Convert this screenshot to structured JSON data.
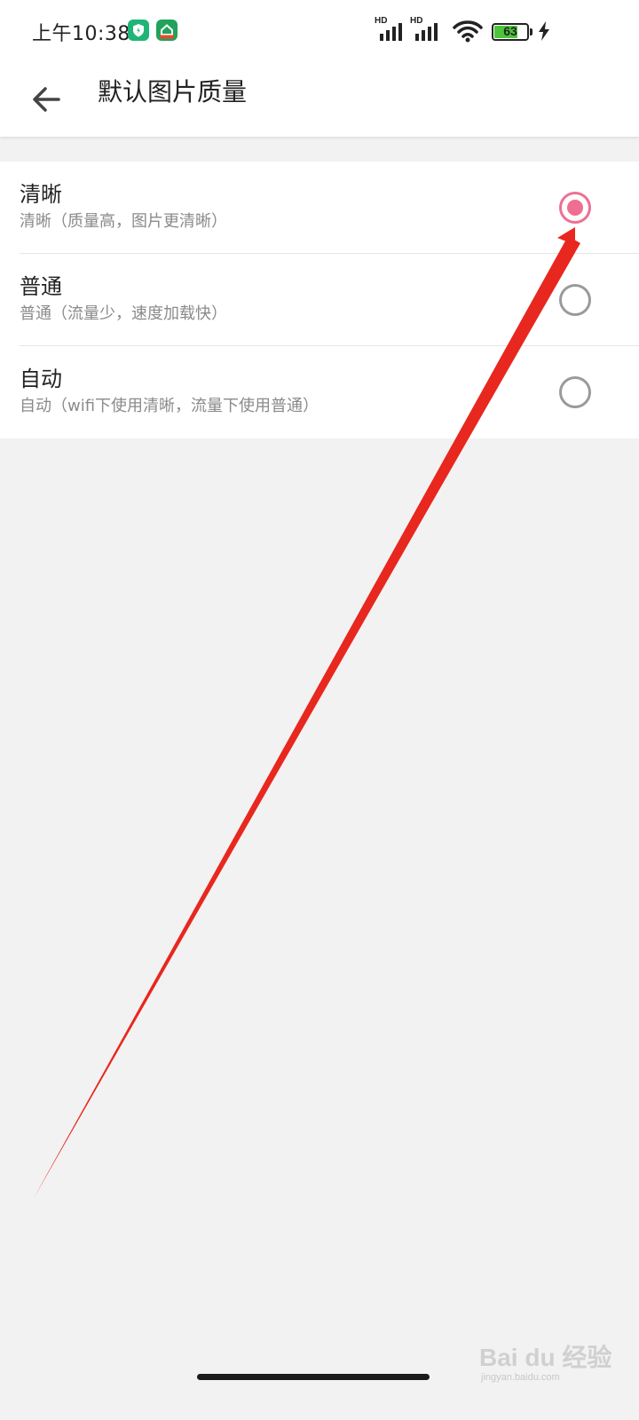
{
  "status_bar": {
    "time": "上午10:38",
    "battery_level": "63",
    "signal_label_1": "HD",
    "signal_label_2": "HD",
    "icons": [
      "shield-app-icon",
      "home-app-icon",
      "signal-icon",
      "signal-icon",
      "wifi-icon",
      "battery-icon",
      "charging-icon"
    ]
  },
  "toolbar": {
    "back_icon": "arrow-left-icon",
    "title": "默认图片质量"
  },
  "options": [
    {
      "title": "清晰",
      "description": "清晰（质量高，图片更清晰）",
      "selected": true
    },
    {
      "title": "普通",
      "description": "普通（流量少，速度加载快）",
      "selected": false
    },
    {
      "title": "自动",
      "description": "自动（wifi下使用清晰，流量下使用普通）",
      "selected": false
    }
  ],
  "colors": {
    "accent": "#ef6f93",
    "annotation_arrow": "#e8271f",
    "radio_unchecked": "#9a9a9a"
  },
  "watermark": {
    "logo": "Bai du 经验",
    "sub": "jingyan.baidu.com"
  }
}
